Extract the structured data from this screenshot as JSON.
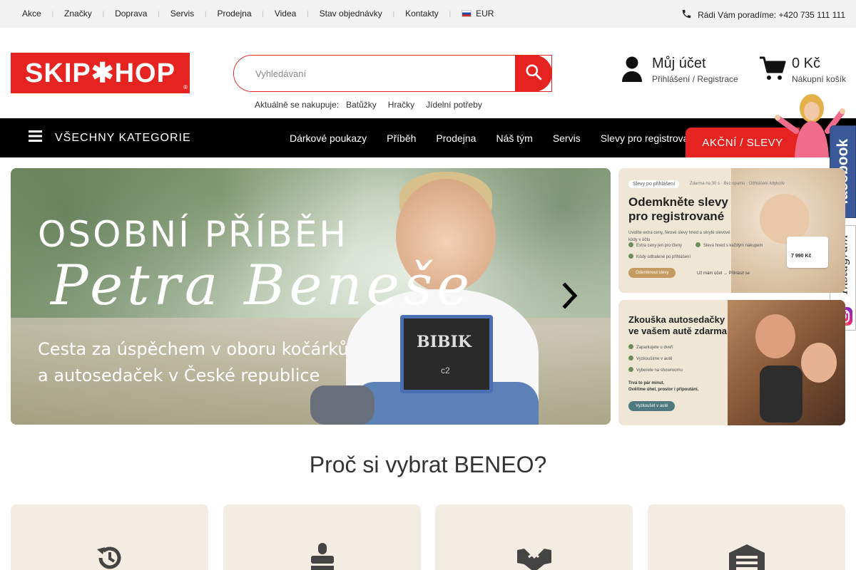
{
  "topnav": {
    "items": [
      "Akce",
      "Značky",
      "Doprava",
      "Servis",
      "Prodejna",
      "Videa",
      "Stav objednávky",
      "Kontakty"
    ],
    "currency": "EUR",
    "separator": "|"
  },
  "contact": {
    "text": "Rádi Vám poradíme: +420 735 111 111"
  },
  "logo": {
    "text": "SKIP✱HOP",
    "reg": "®"
  },
  "search": {
    "placeholder": "Vyhledávaní",
    "popular_label": "Aktuálně se nakupuje:",
    "popular": [
      "Batůžky",
      "Hračky",
      "Jídelní potřeby"
    ]
  },
  "account": {
    "title": "Můj účet",
    "subtitle": "Přihlášení / Registrace"
  },
  "cart": {
    "total": "0 Kč",
    "label": "Nákupní košík"
  },
  "catbar": {
    "all_label": "VŠECHNY KATEGORIE",
    "items": [
      "Dárkové poukazy",
      "Příběh",
      "Prodejna",
      "Náš tým",
      "Servis",
      "Slevy pro registrova"
    ],
    "sale_label": "AKČNÍ / SLEVY"
  },
  "social": {
    "facebook": "facebook",
    "instagram": "Instagram"
  },
  "hero": {
    "title": "OSOBNÍ PŘÍBĚH",
    "script": "Petra Beneše",
    "subtitle_line1": "Cesta za úspěchem v oboru kočárků",
    "subtitle_line2": "a autosedaček v České republice",
    "board_text": "BIBIK",
    "board_small": "c2"
  },
  "banner1": {
    "pill": "Slevy po přihlášení",
    "mini": "Zdarma na 30 s · Bez spamu · Odhlášení kdykoliv",
    "heading_line1": "Odemkněte slevy",
    "heading_line2": "pro registrované",
    "text1": "Uvidíte extra ceny, férové slevy hned a skryté slevové kódy v účtu",
    "bullet1": "Extra ceny jen pro členy",
    "bullet2": "Sleva hned s každým nákupem",
    "bullet3": "Kódy odhalené po přihlášení",
    "button": "Odemknout slevy",
    "link": "Už mám účet → Přihlásit se",
    "price": "7 990 Kč"
  },
  "banner2": {
    "heading_line1": "Zkouška autosedačky",
    "heading_line2": "ve vašem autě zdarma",
    "bullet1": "Zaparkujete u dveří",
    "bullet2": "Vyzkoušíme v autě",
    "bullet3": "Vyberete na showroomu",
    "text1": "Trvá to pár minut.",
    "text2": "Ověříme úhel, prostor i připoutání.",
    "button": "Vyzkoušet v autě"
  },
  "why": {
    "title": "Proč si vybrat BENEO?"
  },
  "features": [
    {
      "icon": "history-icon"
    },
    {
      "icon": "stamp-icon"
    },
    {
      "icon": "handshake-icon"
    },
    {
      "icon": "warehouse-icon"
    }
  ],
  "colors": {
    "brand_red": "#e52421",
    "facebook": "#3b5998",
    "feature_bg": "#f3ece2"
  }
}
